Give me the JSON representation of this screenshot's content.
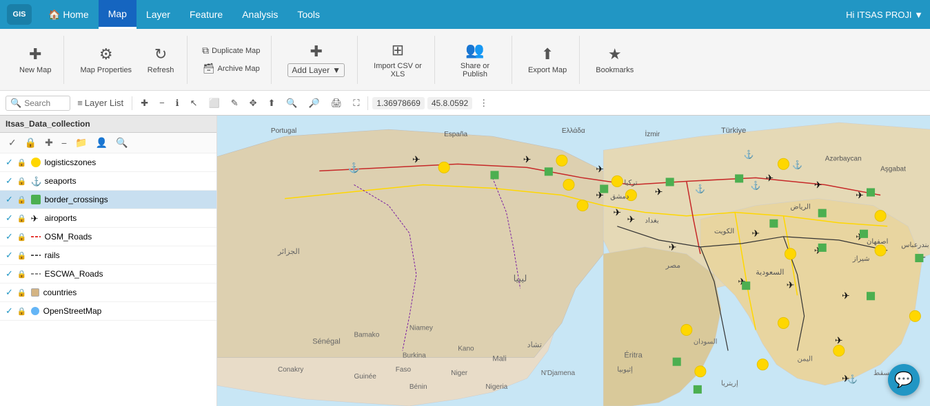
{
  "app": {
    "logo": "GIS",
    "user_greeting": "Hi ITSAS PROJI ▼"
  },
  "nav": {
    "items": [
      {
        "label": "🏠 Home",
        "id": "home",
        "active": false
      },
      {
        "label": "Map",
        "id": "map",
        "active": true
      },
      {
        "label": "Layer",
        "id": "layer",
        "active": false
      },
      {
        "label": "Feature",
        "id": "feature",
        "active": false
      },
      {
        "label": "Analysis",
        "id": "analysis",
        "active": false
      },
      {
        "label": "Tools",
        "id": "tools",
        "active": false
      }
    ]
  },
  "toolbar": {
    "new_map_label": "New Map",
    "map_properties_label": "Map Properties",
    "refresh_label": "Refresh",
    "duplicate_map_label": "Duplicate Map",
    "archive_map_label": "Archive Map",
    "add_layer_label": "Add Layer",
    "import_csv_label": "Import CSV or XLS",
    "share_publish_label": "Share or Publish",
    "export_map_label": "Export Map",
    "bookmarks_label": "Bookmarks"
  },
  "map_toolbar": {
    "search_label": "Search",
    "layer_list_label": "Layer List",
    "coord_x": "1.36978669",
    "coord_y": "45.8.0592"
  },
  "layer_panel": {
    "collection_name": "Itsas_Data_collection",
    "layers": [
      {
        "id": "logisticszones",
        "label": "logisticszones",
        "icon_type": "yellow-circle",
        "visible": true,
        "selected": false
      },
      {
        "id": "seaports",
        "label": "seaports",
        "icon_type": "anchor",
        "visible": true,
        "selected": false
      },
      {
        "id": "border_crossings",
        "label": "border_crossings",
        "icon_type": "green-square",
        "visible": true,
        "selected": true
      },
      {
        "id": "airoports",
        "label": "airoports",
        "icon_type": "plane",
        "visible": true,
        "selected": false
      },
      {
        "id": "OSM_Roads",
        "label": "OSM_Roads",
        "icon_type": "line-red",
        "visible": true,
        "selected": false
      },
      {
        "id": "rails",
        "label": "rails",
        "icon_type": "line-rail",
        "visible": true,
        "selected": false
      },
      {
        "id": "ESCWA_Roads",
        "label": "ESCWA_Roads",
        "icon_type": "line-road",
        "visible": true,
        "selected": false
      },
      {
        "id": "countries",
        "label": "countries",
        "icon_type": "tan-square",
        "visible": true,
        "selected": false
      },
      {
        "id": "OpenStreetMap",
        "label": "OpenStreetMap",
        "icon_type": "osm",
        "visible": true,
        "selected": false
      }
    ]
  }
}
